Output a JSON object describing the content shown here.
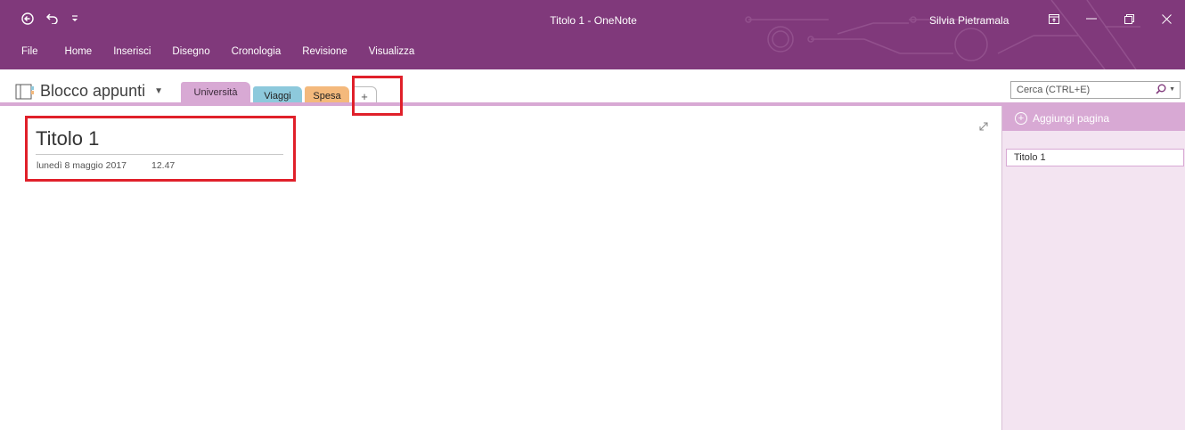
{
  "window": {
    "title": "Titolo 1 - OneNote",
    "user": "Silvia Pietramala",
    "accent": "#80397b"
  },
  "qat": {
    "back_icon": "back-arrow-circle-icon",
    "undo_icon": "undo-icon",
    "customize_icon": "customize-qat-icon"
  },
  "menu": {
    "items": [
      "File",
      "Home",
      "Inserisci",
      "Disegno",
      "Cronologia",
      "Revisione",
      "Visualizza"
    ]
  },
  "notebook": {
    "name": "Blocco appunti",
    "sections": [
      {
        "label": "Università",
        "color": "#d8a9d4"
      },
      {
        "label": "Viaggi",
        "color": "#8dc9dc"
      },
      {
        "label": "Spesa",
        "color": "#f4b97c"
      }
    ],
    "add_tab": "+"
  },
  "search": {
    "placeholder": "Cerca (CTRL+E)"
  },
  "page": {
    "title": "Titolo 1",
    "date": "lunedì 8 maggio 2017",
    "time": "12.47"
  },
  "pages_panel": {
    "add_page": "Aggiungi pagina",
    "items": [
      "Titolo 1"
    ]
  },
  "highlights": {
    "color": "#e0202a"
  }
}
